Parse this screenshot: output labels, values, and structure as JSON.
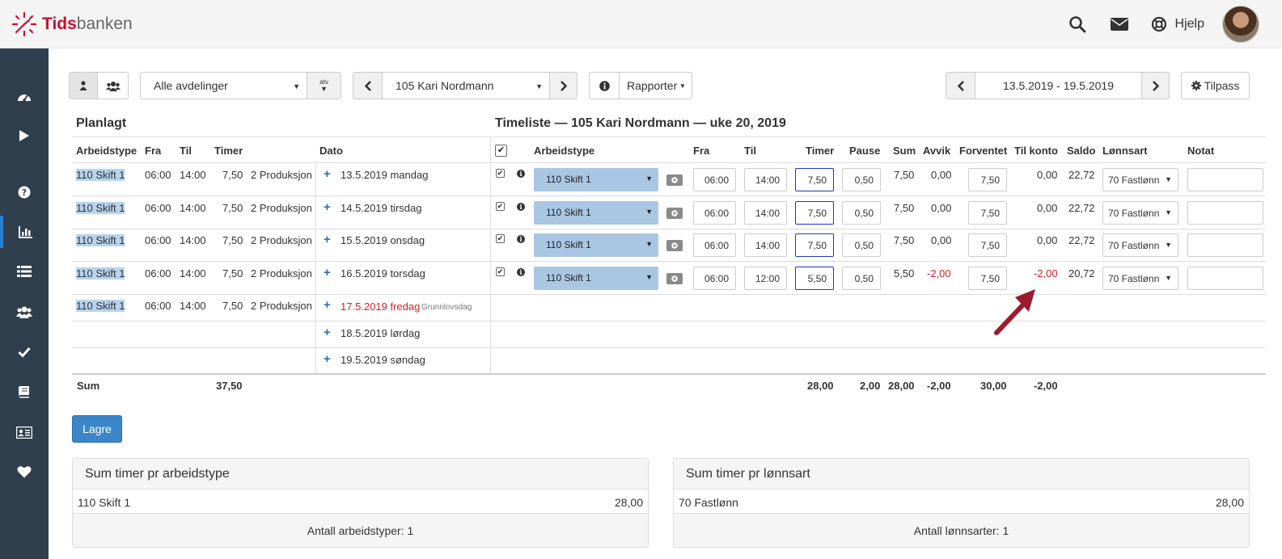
{
  "app": {
    "logo_a": "Tids",
    "logo_b": "banken",
    "help_label": "Hjelp"
  },
  "toolbar": {
    "department": "Alle avdelinger",
    "atv_label": "atv",
    "employee": "105 Kari Nordmann",
    "reports_label": "Rapporter",
    "date_range": "13.5.2019 - 19.5.2019",
    "customize_label": "Tilpass"
  },
  "planned": {
    "title": "Planlagt",
    "headers": {
      "arbeidstype": "Arbeidstype",
      "fra": "Fra",
      "til": "Til",
      "timer": "Timer",
      "dato": "Dato"
    },
    "rows": [
      {
        "type": "110 Skift 1",
        "fra": "06:00",
        "til": "14:00",
        "timer": "7,50",
        "dept": "2 Produksjon",
        "date": "13.5.2019 mandag",
        "note": ""
      },
      {
        "type": "110 Skift 1",
        "fra": "06:00",
        "til": "14:00",
        "timer": "7,50",
        "dept": "2 Produksjon",
        "date": "14.5.2019 tirsdag",
        "note": ""
      },
      {
        "type": "110 Skift 1",
        "fra": "06:00",
        "til": "14:00",
        "timer": "7,50",
        "dept": "2 Produksjon",
        "date": "15.5.2019 onsdag",
        "note": ""
      },
      {
        "type": "110 Skift 1",
        "fra": "06:00",
        "til": "14:00",
        "timer": "7,50",
        "dept": "2 Produksjon",
        "date": "16.5.2019 torsdag",
        "note": ""
      },
      {
        "type": "110 Skift 1",
        "fra": "06:00",
        "til": "14:00",
        "timer": "7,50",
        "dept": "2 Produksjon",
        "date": "17.5.2019 fredag",
        "note": "Grunnlovsdag"
      },
      {
        "type": "",
        "fra": "",
        "til": "",
        "timer": "",
        "dept": "",
        "date": "18.5.2019 lørdag",
        "note": ""
      },
      {
        "type": "",
        "fra": "",
        "til": "",
        "timer": "",
        "dept": "",
        "date": "19.5.2019 søndag",
        "note": ""
      }
    ],
    "sum_label": "Sum",
    "sum_timer": "37,50"
  },
  "timesheet": {
    "title": "Timeliste — 105 Kari Nordmann — uke 20, 2019",
    "headers": {
      "arbeidstype": "Arbeidstype",
      "fra": "Fra",
      "til": "Til",
      "timer": "Timer",
      "pause": "Pause",
      "sum": "Sum",
      "avvik": "Avvik",
      "forventet": "Forventet",
      "til_konto": "Til konto",
      "saldo": "Saldo",
      "lonnsart": "Lønnsart",
      "notat": "Notat"
    },
    "rows": [
      {
        "type": "110 Skift 1",
        "fra": "06:00",
        "til": "14:00",
        "timer": "7,50",
        "pause": "0,50",
        "sum": "7,50",
        "avvik": "0,00",
        "forventet": "7,50",
        "til_konto": "0,00",
        "saldo": "22,72",
        "lonnsart": "70 Fastlønn"
      },
      {
        "type": "110 Skift 1",
        "fra": "06:00",
        "til": "14:00",
        "timer": "7,50",
        "pause": "0,50",
        "sum": "7,50",
        "avvik": "0,00",
        "forventet": "7,50",
        "til_konto": "0,00",
        "saldo": "22,72",
        "lonnsart": "70 Fastlønn"
      },
      {
        "type": "110 Skift 1",
        "fra": "06:00",
        "til": "14:00",
        "timer": "7,50",
        "pause": "0,50",
        "sum": "7,50",
        "avvik": "0,00",
        "forventet": "7,50",
        "til_konto": "0,00",
        "saldo": "22,72",
        "lonnsart": "70 Fastlønn"
      },
      {
        "type": "110 Skift 1",
        "fra": "06:00",
        "til": "12:00",
        "timer": "5,50",
        "pause": "0,50",
        "sum": "5,50",
        "avvik": "-2,00",
        "forventet": "7,50",
        "til_konto": "-2,00",
        "saldo": "20,72",
        "lonnsart": "70 Fastlønn"
      }
    ],
    "sums": {
      "timer": "28,00",
      "pause": "2,00",
      "sum": "28,00",
      "avvik": "-2,00",
      "forventet": "30,00",
      "til_konto": "-2,00"
    }
  },
  "save_label": "Lagre",
  "panel_type": {
    "title": "Sum timer pr arbeidstype",
    "row_label": "110 Skift 1",
    "row_value": "28,00",
    "footer": "Antall arbeidstyper: 1"
  },
  "panel_wage": {
    "title": "Sum timer pr lønnsart",
    "row_label": "70 Fastlønn",
    "row_value": "28,00",
    "footer": "Antall lønnsarter: 1"
  },
  "colors": {
    "sidebar": "#2f3f4d",
    "accent": "#3a86c8",
    "negative": "#d62020",
    "highlight": "#b7d3ee",
    "arrow": "#9b1b30"
  }
}
